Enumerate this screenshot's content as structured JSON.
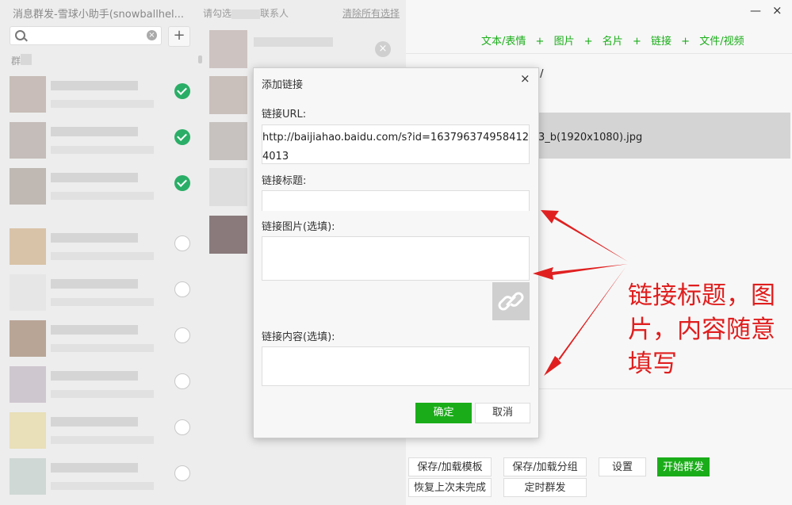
{
  "window": {
    "title": "消息群发-雪球小助手(snowballhel...",
    "hint": "请勾选",
    "hint_suffix": "联系人",
    "clear_all": "清除所有选择",
    "minimize": "—",
    "close": "×"
  },
  "left": {
    "search_clear": "×",
    "add": "+",
    "group_label": "群",
    "rows": [
      {
        "checked": true
      },
      {
        "checked": true
      },
      {
        "checked": true
      },
      {
        "checked": false
      },
      {
        "checked": false
      },
      {
        "checked": false
      },
      {
        "checked": false
      },
      {
        "checked": false
      },
      {
        "checked": false
      }
    ]
  },
  "toolbar": {
    "text_emoji": "文本/表情",
    "image": "图片",
    "card": "名片",
    "link": "链接",
    "file_video": "文件/视频",
    "plus": "+"
  },
  "content": {
    "url_fragment": ")/",
    "file_fragment": "3_b(1920x1080).jpg"
  },
  "bottom": {
    "save_template": "保存/加载模板",
    "save_group": "保存/加载分组",
    "settings": "设置",
    "start": "开始群发",
    "restore": "恢复上次未完成",
    "schedule": "定时群发"
  },
  "dialog": {
    "title": "添加链接",
    "close": "×",
    "url_label": "链接URL:",
    "url_value": "http://baijiahao.baidu.com/s?id=1637963749584124013",
    "title_label": "链接标题:",
    "title_value": "",
    "image_label": "链接图片(选填):",
    "content_label": "链接内容(选填):",
    "ok": "确定",
    "cancel": "取消"
  },
  "annotation": {
    "text": "链接标题，图片，内容随意填写",
    "color": "#e01e1e"
  }
}
